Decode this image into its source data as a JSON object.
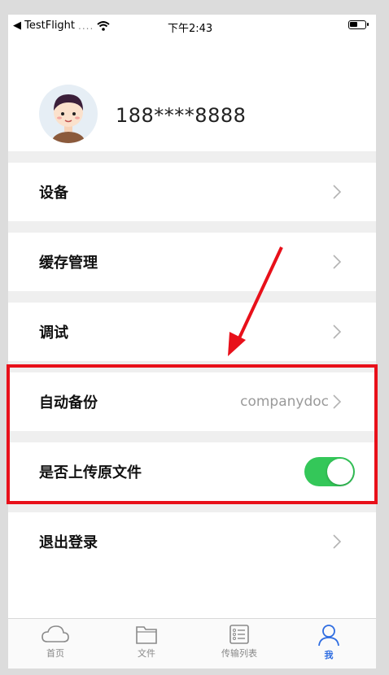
{
  "status_bar": {
    "back_app": "◀ TestFlight",
    "signal_dots": "....",
    "time": "下午2:43"
  },
  "profile": {
    "phone": "188****8888"
  },
  "menu": {
    "devices": "设备",
    "cache": "缓存管理",
    "debug": "调试",
    "auto_backup": "自动备份",
    "auto_backup_value": "companydoc",
    "upload_original": "是否上传原文件",
    "upload_original_on": true,
    "logout": "退出登录"
  },
  "tabs": [
    {
      "label": "首页",
      "icon": "cloud-icon"
    },
    {
      "label": "文件",
      "icon": "folder-icon"
    },
    {
      "label": "传输列表",
      "icon": "list-icon"
    },
    {
      "label": "我",
      "icon": "person-icon",
      "active": true
    }
  ],
  "colors": {
    "accent": "#2f6de1",
    "toggle_on": "#34c759",
    "highlight": "#e8101a"
  }
}
